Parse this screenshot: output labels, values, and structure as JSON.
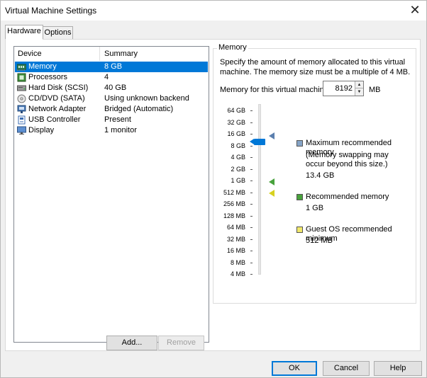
{
  "window": {
    "title": "Virtual Machine Settings",
    "close_glyph": "✕"
  },
  "tabs": [
    {
      "label": "Hardware"
    },
    {
      "label": "Options"
    }
  ],
  "device_list": {
    "headers": {
      "device": "Device",
      "summary": "Summary"
    },
    "rows": [
      {
        "device": "Memory",
        "summary": "8 GB",
        "icon": "memory-icon",
        "selected": true
      },
      {
        "device": "Processors",
        "summary": "4",
        "icon": "processor-icon"
      },
      {
        "device": "Hard Disk (SCSI)",
        "summary": "40 GB",
        "icon": "hard-disk-icon"
      },
      {
        "device": "CD/DVD (SATA)",
        "summary": "Using unknown backend",
        "icon": "cd-dvd-icon"
      },
      {
        "device": "Network Adapter",
        "summary": "Bridged (Automatic)",
        "icon": "network-adapter-icon"
      },
      {
        "device": "USB Controller",
        "summary": "Present",
        "icon": "usb-controller-icon"
      },
      {
        "device": "Display",
        "summary": "1 monitor",
        "icon": "display-icon"
      }
    ]
  },
  "list_buttons": {
    "add": "Add...",
    "remove": "Remove"
  },
  "memory": {
    "group_title": "Memory",
    "description": "Specify the amount of memory allocated to this virtual machine. The memory size must be a multiple of 4 MB.",
    "field_label": "Memory for this virtual machine:",
    "value": "8192",
    "unit": "MB",
    "scale": [
      "64 GB",
      "32 GB",
      "16 GB",
      "8 GB",
      "4 GB",
      "2 GB",
      "1 GB",
      "512 MB",
      "256 MB",
      "128 MB",
      "64 MB",
      "32 MB",
      "16 MB",
      "8 MB",
      "4 MB"
    ],
    "legend": {
      "max": {
        "title": "Maximum recommended memory",
        "note": "(Memory swapping may occur beyond this size.)",
        "value": "13.4 GB",
        "color": "#86a4c7"
      },
      "recommended": {
        "title": "Recommended memory",
        "value": "1 GB",
        "color": "#48a23c"
      },
      "guest_min": {
        "title": "Guest OS recommended minimum",
        "value": "512 MB",
        "color": "#f1e86a"
      }
    }
  },
  "dialog_buttons": {
    "ok": "OK",
    "cancel": "Cancel",
    "help": "Help"
  },
  "colors": {
    "selection": "#0078d7",
    "slider_thumb": "#0078d7"
  }
}
